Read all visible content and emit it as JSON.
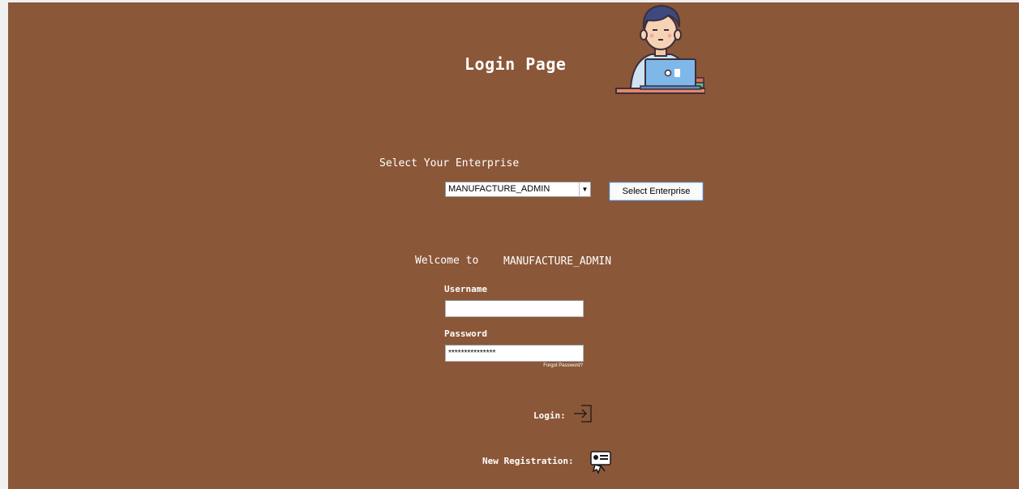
{
  "page": {
    "title": "Login Page",
    "avatar_icon": "person-at-laptop-icon"
  },
  "enterprise": {
    "label": "Select Your Enterprise",
    "selected_value": "MANUFACTURE_ADMIN",
    "select_button_label": "Select Enterprise"
  },
  "welcome": {
    "text": "Welcome to",
    "enterprise_name": "MANUFACTURE_ADMIN"
  },
  "login_form": {
    "username_label": "Username",
    "username_value": "",
    "password_label": "Password",
    "password_value": "***************",
    "forgot_password_label": "Forgot Password?",
    "login_label": "Login:",
    "login_icon": "sign-in-icon",
    "registration_label": "New Registration:",
    "registration_icon": "registration-card-icon"
  },
  "colors": {
    "background": "#8a5738",
    "text": "#ffffff"
  }
}
